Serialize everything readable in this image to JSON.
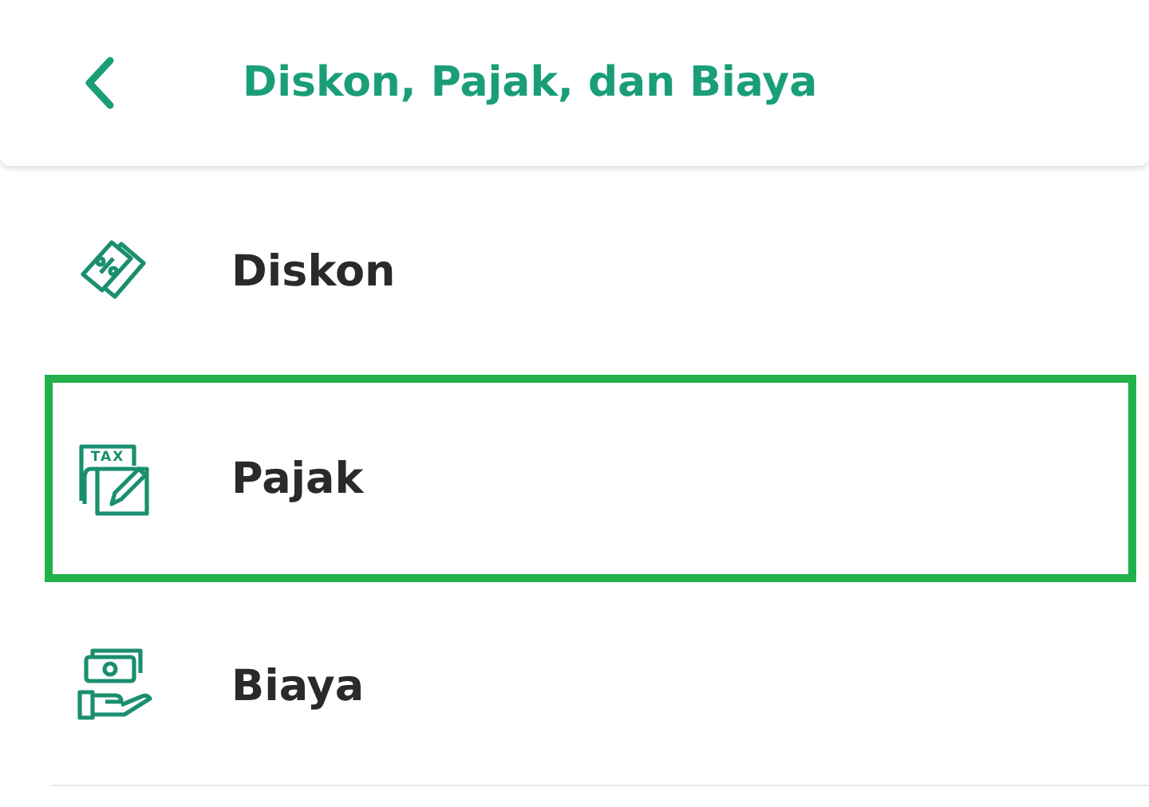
{
  "header": {
    "title": "Diskon, Pajak, dan Biaya"
  },
  "items": [
    {
      "kind": "discount",
      "label": "Diskon",
      "highlighted": false
    },
    {
      "kind": "tax",
      "label": "Pajak",
      "icon_label": "TAX",
      "highlighted": true
    },
    {
      "kind": "fee",
      "label": "Biaya",
      "highlighted": false
    }
  ]
}
